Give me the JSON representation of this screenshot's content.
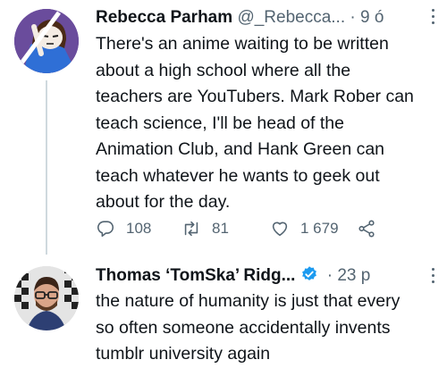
{
  "tweets": [
    {
      "author_name": "Rebecca Parham",
      "handle": "@_Rebecca...",
      "time": "· 9 ó",
      "text_lines": [
        "There's an anime waiting to be written",
        "about a high school where all the",
        "teachers are YouTubers. Mark Rober can",
        "teach science, I'll be head of the",
        "Animation Club, and Hank Green can",
        "teach whatever he wants to geek out",
        "about for the day."
      ],
      "replies": "108",
      "retweets": "81",
      "likes": "1 679"
    },
    {
      "author_name": "Thomas ‘TomSka’ Ridg...",
      "time": "· 23 p",
      "text_lines": [
        "the nature of humanity is just that every",
        "so often someone accidentally invents",
        "tumblr university again"
      ]
    }
  ],
  "colors": {
    "text": "#0f1419",
    "secondary": "#536471",
    "verified": "#1d9bf0",
    "avatar1_bg": "#6a4c9c"
  },
  "icons": [
    "reply-icon",
    "retweet-icon",
    "like-icon",
    "share-icon",
    "verified-icon",
    "more-icon"
  ]
}
